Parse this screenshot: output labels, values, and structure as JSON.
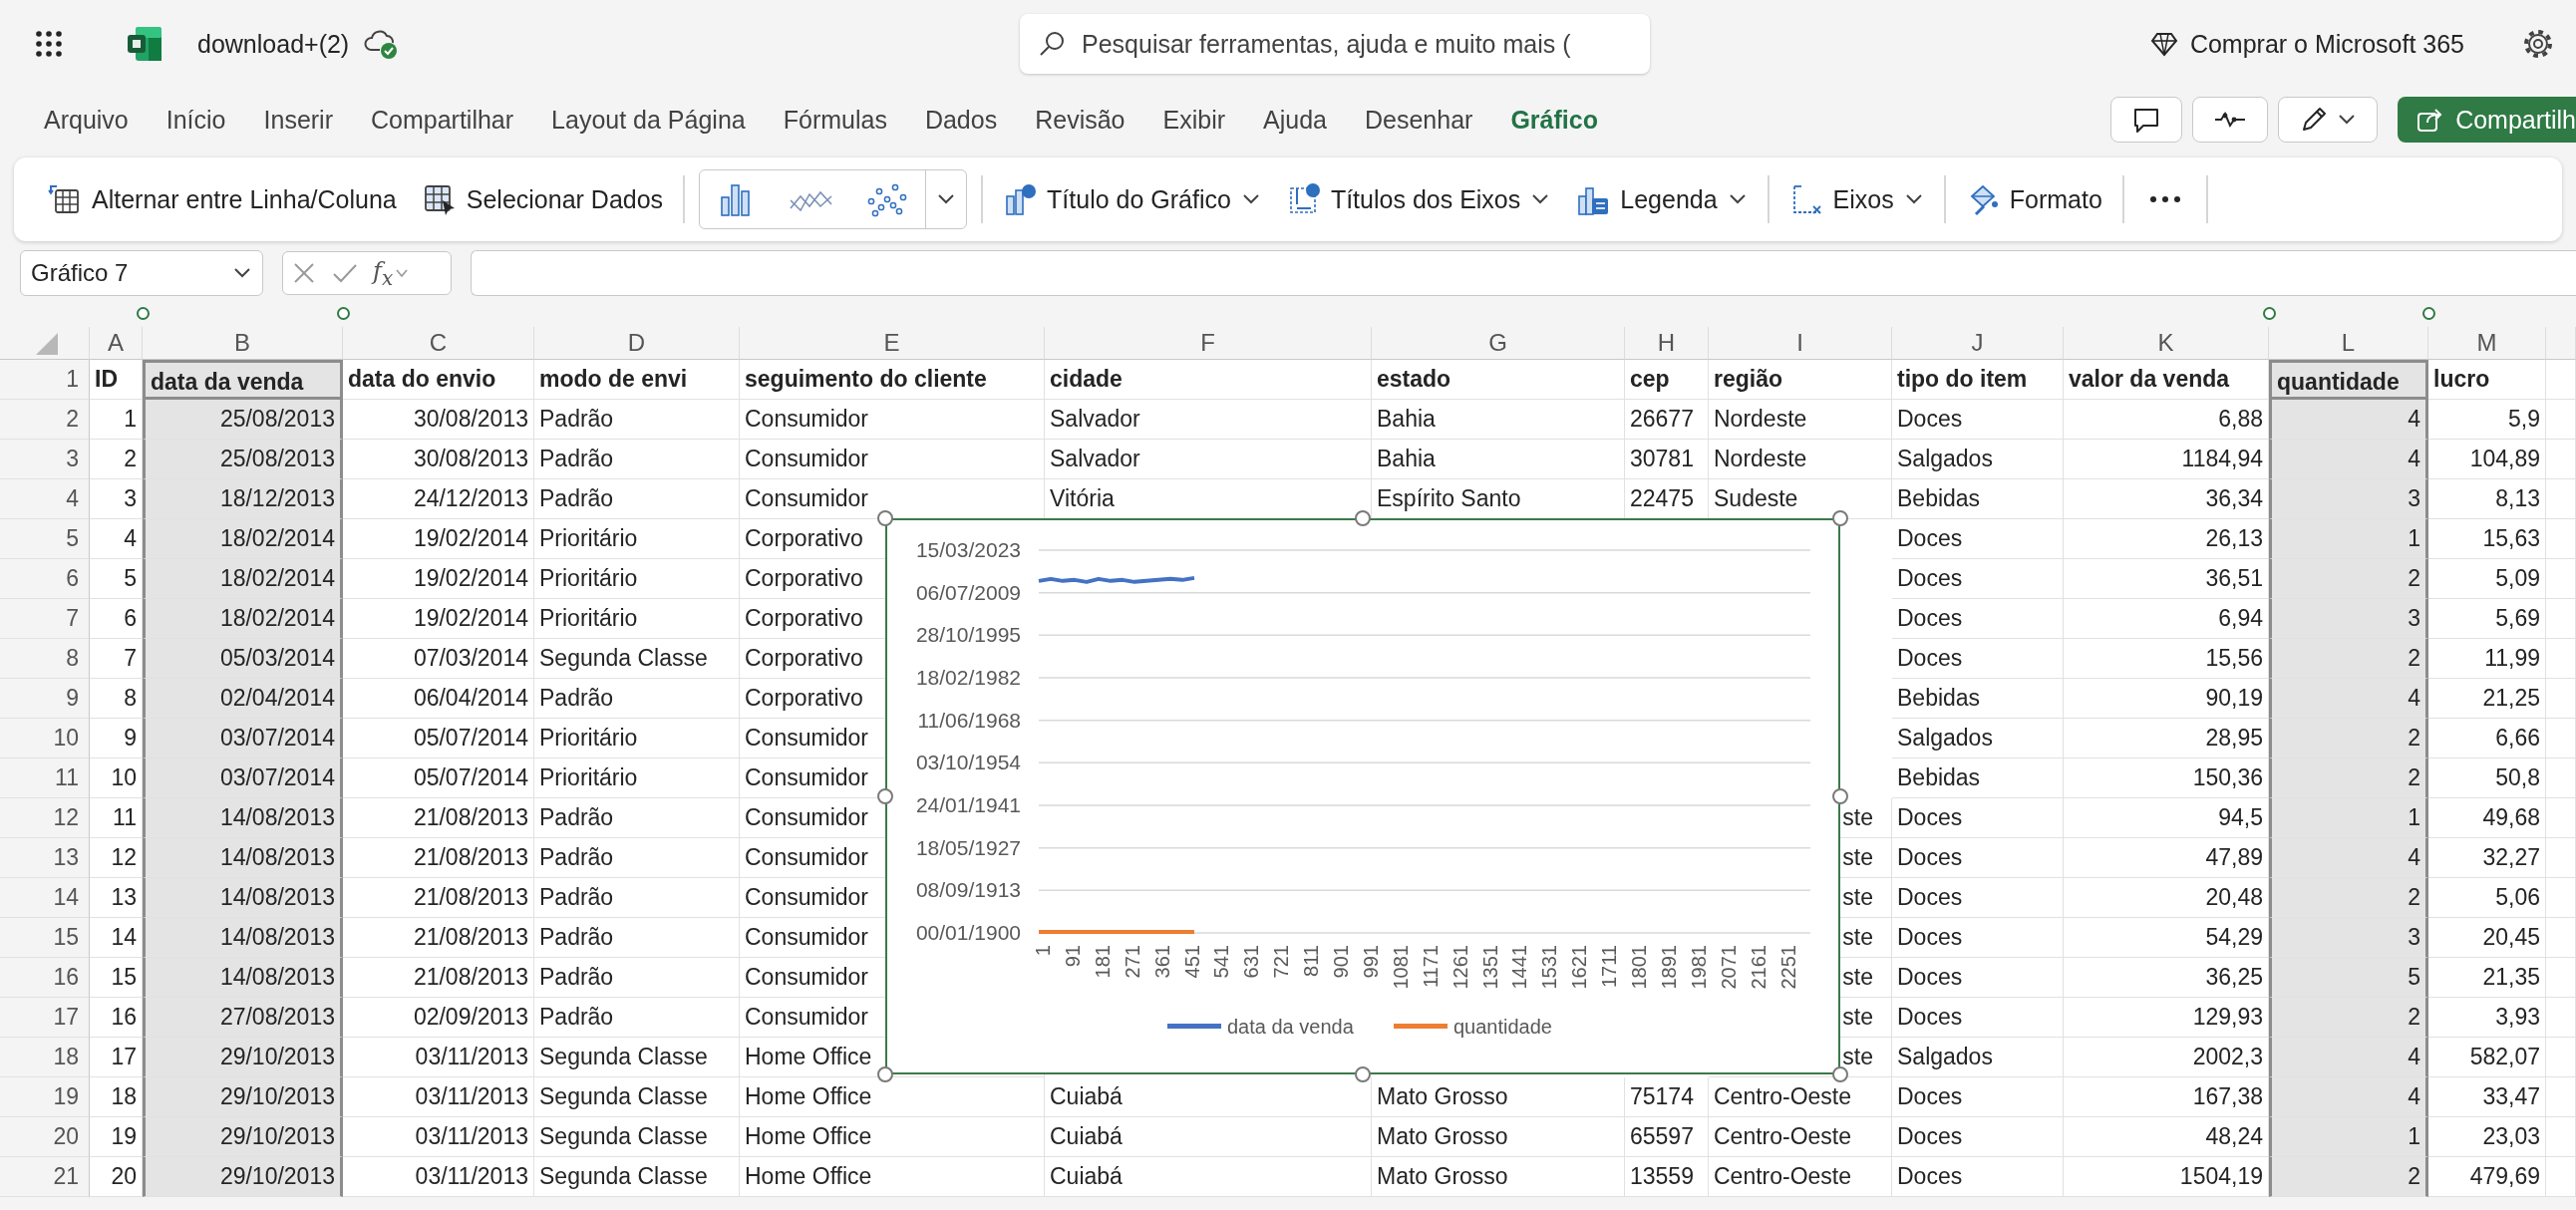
{
  "app_bar": {
    "file_name": "download+(2)",
    "search": {
      "placeholder": "Pesquisar ferramentas, ajuda e muito mais ("
    },
    "buy_label": "Comprar o Microsoft 365"
  },
  "menu_tabs": [
    {
      "label": "Arquivo",
      "selected": false
    },
    {
      "label": "Início",
      "selected": false
    },
    {
      "label": "Inserir",
      "selected": false
    },
    {
      "label": "Compartilhar",
      "selected": false
    },
    {
      "label": "Layout da Página",
      "selected": false
    },
    {
      "label": "Fórmulas",
      "selected": false
    },
    {
      "label": "Dados",
      "selected": false
    },
    {
      "label": "Revisão",
      "selected": false
    },
    {
      "label": "Exibir",
      "selected": false
    },
    {
      "label": "Ajuda",
      "selected": false
    },
    {
      "label": "Desenhar",
      "selected": false
    },
    {
      "label": "Gráfico",
      "selected": true
    }
  ],
  "share_button": {
    "label": "Compartilh"
  },
  "ribbon": [
    {
      "kind": "button",
      "label": "Alternar entre Linha/Coluna",
      "dropdown": false
    },
    {
      "kind": "button",
      "label": "Selecionar Dados",
      "dropdown": false
    },
    {
      "kind": "separator"
    },
    {
      "kind": "gallery"
    },
    {
      "kind": "separator"
    },
    {
      "kind": "button",
      "label": "Título do Gráfico",
      "dropdown": true
    },
    {
      "kind": "button",
      "label": "Títulos dos Eixos",
      "dropdown": true
    },
    {
      "kind": "button",
      "label": "Legenda",
      "dropdown": true
    },
    {
      "kind": "separator"
    },
    {
      "kind": "button",
      "label": "Eixos",
      "dropdown": true
    },
    {
      "kind": "separator"
    },
    {
      "kind": "button",
      "label": "Formato",
      "dropdown": false
    },
    {
      "kind": "separator"
    },
    {
      "kind": "more"
    },
    {
      "kind": "separator"
    }
  ],
  "formula_bar": {
    "name_box": "Gráfico 7",
    "function_label": "f$_{x}$"
  },
  "sheet": {
    "columns": [
      {
        "letter": "A",
        "kind": "number",
        "selected": false
      },
      {
        "letter": "B",
        "kind": "number",
        "selected": true
      },
      {
        "letter": "C",
        "kind": "number",
        "selected": false
      },
      {
        "letter": "D",
        "kind": "text",
        "selected": false
      },
      {
        "letter": "E",
        "kind": "text",
        "selected": false
      },
      {
        "letter": "F",
        "kind": "text",
        "selected": false
      },
      {
        "letter": "G",
        "kind": "text",
        "selected": false
      },
      {
        "letter": "H",
        "kind": "text",
        "selected": false
      },
      {
        "letter": "I",
        "kind": "text",
        "selected": false
      },
      {
        "letter": "J",
        "kind": "text",
        "selected": false
      },
      {
        "letter": "K",
        "kind": "number",
        "selected": false
      },
      {
        "letter": "L",
        "kind": "number",
        "selected": true
      },
      {
        "letter": "M",
        "kind": "number",
        "selected": false
      }
    ],
    "rows": [
      {
        "number": "1",
        "kind": "header",
        "cells": {
          "A": "ID",
          "B": "data da venda",
          "C": "data do envio",
          "D": "modo de envi",
          "E": "seguimento do cliente",
          "F": "cidade",
          "G": "estado",
          "H": "cep",
          "I": "região",
          "J": "tipo do item",
          "K": "valor da venda",
          "L": "quantidade",
          "M": "lucro"
        }
      },
      {
        "number": "2",
        "kind": "data",
        "cells": {
          "A": "1",
          "B": "25/08/2013",
          "C": "30/08/2013",
          "D": "Padrão",
          "E": "Consumidor",
          "F": "Salvador",
          "G": "Bahia",
          "H": "26677",
          "I": "Nordeste",
          "J": "Doces",
          "K": "6,88",
          "L": "4",
          "M": "5,9"
        }
      },
      {
        "number": "3",
        "kind": "data",
        "cells": {
          "A": "2",
          "B": "25/08/2013",
          "C": "30/08/2013",
          "D": "Padrão",
          "E": "Consumidor",
          "F": "Salvador",
          "G": "Bahia",
          "H": "30781",
          "I": "Nordeste",
          "J": "Salgados",
          "K": "1184,94",
          "L": "4",
          "M": "104,89"
        }
      },
      {
        "number": "4",
        "kind": "data",
        "cells": {
          "A": "3",
          "B": "18/12/2013",
          "C": "24/12/2013",
          "D": "Padrão",
          "E": "Consumidor",
          "F": "Vitória",
          "G": "Espírito Santo",
          "H": "22475",
          "I": "Sudeste",
          "J": "Bebidas",
          "K": "36,34",
          "L": "3",
          "M": "8,13"
        }
      },
      {
        "number": "5",
        "kind": "data",
        "cells": {
          "A": "4",
          "B": "18/02/2014",
          "C": "19/02/2014",
          "D": "Prioritário",
          "E": "Corporativo",
          "J": "Doces",
          "K": "26,13",
          "L": "1",
          "M": "15,63"
        }
      },
      {
        "number": "6",
        "kind": "data",
        "cells": {
          "A": "5",
          "B": "18/02/2014",
          "C": "19/02/2014",
          "D": "Prioritário",
          "E": "Corporativo",
          "J": "Doces",
          "K": "36,51",
          "L": "2",
          "M": "5,09"
        }
      },
      {
        "number": "7",
        "kind": "data",
        "cells": {
          "A": "6",
          "B": "18/02/2014",
          "C": "19/02/2014",
          "D": "Prioritário",
          "E": "Corporativo",
          "J": "Doces",
          "K": "6,94",
          "L": "3",
          "M": "5,69"
        }
      },
      {
        "number": "8",
        "kind": "data",
        "cells": {
          "A": "7",
          "B": "05/03/2014",
          "C": "07/03/2014",
          "D": "Segunda Classe",
          "E": "Corporativo",
          "J": "Doces",
          "K": "15,56",
          "L": "2",
          "M": "11,99"
        }
      },
      {
        "number": "9",
        "kind": "data",
        "cells": {
          "A": "8",
          "B": "02/04/2014",
          "C": "06/04/2014",
          "D": "Padrão",
          "E": "Corporativo",
          "J": "Bebidas",
          "K": "90,19",
          "L": "4",
          "M": "21,25"
        }
      },
      {
        "number": "10",
        "kind": "data",
        "cells": {
          "A": "9",
          "B": "03/07/2014",
          "C": "05/07/2014",
          "D": "Prioritário",
          "E": "Consumidor",
          "J": "Salgados",
          "K": "28,95",
          "L": "2",
          "M": "6,66"
        }
      },
      {
        "number": "11",
        "kind": "data",
        "cells": {
          "A": "10",
          "B": "03/07/2014",
          "C": "05/07/2014",
          "D": "Prioritário",
          "E": "Consumidor",
          "J": "Bebidas",
          "K": "150,36",
          "L": "2",
          "M": "50,8"
        }
      },
      {
        "number": "12",
        "kind": "data",
        "cells": {
          "A": "11",
          "B": "14/08/2013",
          "C": "21/08/2013",
          "D": "Padrão",
          "E": "Consumidor",
          "I": {
            "text": "ste",
            "clipped": true
          },
          "J": "Doces",
          "K": "94,5",
          "L": "1",
          "M": "49,68"
        }
      },
      {
        "number": "13",
        "kind": "data",
        "cells": {
          "A": "12",
          "B": "14/08/2013",
          "C": "21/08/2013",
          "D": "Padrão",
          "E": "Consumidor",
          "I": {
            "text": "ste",
            "clipped": true
          },
          "J": "Doces",
          "K": "47,89",
          "L": "4",
          "M": "32,27"
        }
      },
      {
        "number": "14",
        "kind": "data",
        "cells": {
          "A": "13",
          "B": "14/08/2013",
          "C": "21/08/2013",
          "D": "Padrão",
          "E": "Consumidor",
          "I": {
            "text": "ste",
            "clipped": true
          },
          "J": "Doces",
          "K": "20,48",
          "L": "2",
          "M": "5,06"
        }
      },
      {
        "number": "15",
        "kind": "data",
        "cells": {
          "A": "14",
          "B": "14/08/2013",
          "C": "21/08/2013",
          "D": "Padrão",
          "E": "Consumidor",
          "I": {
            "text": "ste",
            "clipped": true
          },
          "J": "Doces",
          "K": "54,29",
          "L": "3",
          "M": "20,45"
        }
      },
      {
        "number": "16",
        "kind": "data",
        "cells": {
          "A": "15",
          "B": "14/08/2013",
          "C": "21/08/2013",
          "D": "Padrão",
          "E": "Consumidor",
          "I": {
            "text": "ste",
            "clipped": true
          },
          "J": "Doces",
          "K": "36,25",
          "L": "5",
          "M": "21,35"
        }
      },
      {
        "number": "17",
        "kind": "data",
        "cells": {
          "A": "16",
          "B": "27/08/2013",
          "C": "02/09/2013",
          "D": "Padrão",
          "E": "Consumidor",
          "I": {
            "text": "ste",
            "clipped": true
          },
          "J": "Doces",
          "K": "129,93",
          "L": "2",
          "M": "3,93"
        }
      },
      {
        "number": "18",
        "kind": "data",
        "cells": {
          "A": "17",
          "B": "29/10/2013",
          "C": "03/11/2013",
          "D": "Segunda Classe",
          "E": "Home Office",
          "I": {
            "text": "ste",
            "clipped": true
          },
          "J": "Salgados",
          "K": "2002,3",
          "L": "4",
          "M": "582,07"
        }
      },
      {
        "number": "19",
        "kind": "data",
        "cells": {
          "A": "18",
          "B": "29/10/2013",
          "C": "03/11/2013",
          "D": "Segunda Classe",
          "E": "Home Office",
          "F": "Cuiabá",
          "G": "Mato Grosso",
          "H": "75174",
          "I": "Centro-Oeste",
          "J": "Doces",
          "K": "167,38",
          "L": "4",
          "M": "33,47"
        }
      },
      {
        "number": "20",
        "kind": "data",
        "cells": {
          "A": "19",
          "B": "29/10/2013",
          "C": "03/11/2013",
          "D": "Segunda Classe",
          "E": "Home Office",
          "F": "Cuiabá",
          "G": "Mato Grosso",
          "H": "65597",
          "I": "Centro-Oeste",
          "J": "Doces",
          "K": "48,24",
          "L": "1",
          "M": "23,03"
        }
      },
      {
        "number": "21",
        "kind": "data",
        "cells": {
          "A": "20",
          "B": "29/10/2013",
          "C": "03/11/2013",
          "D": "Segunda Classe",
          "E": "Home Office",
          "F": "Cuiabá",
          "G": "Mato Grosso",
          "H": "13559",
          "I": "Centro-Oeste",
          "J": "Doces",
          "K": "1504,19",
          "L": "2",
          "M": "479,69"
        }
      }
    ]
  },
  "chart": {
    "selected": true,
    "y_labels": [
      "15/03/2023",
      "06/07/2009",
      "28/10/1995",
      "18/02/1982",
      "11/06/1968",
      "03/10/1954",
      "24/01/1941",
      "18/05/1927",
      "08/09/1913",
      "00/01/1900"
    ],
    "x_labels": [
      "1",
      "91",
      "181",
      "271",
      "361",
      "451",
      "541",
      "631",
      "721",
      "811",
      "901",
      "991",
      "1081",
      "1171",
      "1261",
      "1351",
      "1441",
      "1531",
      "1621",
      "1711",
      "1801",
      "1891",
      "1981",
      "2071",
      "2161",
      "2251"
    ],
    "series": [
      {
        "name": "data da venda",
        "color": "#4472c4"
      },
      {
        "name": "quantidade",
        "color": "#ed7d31"
      }
    ]
  }
}
